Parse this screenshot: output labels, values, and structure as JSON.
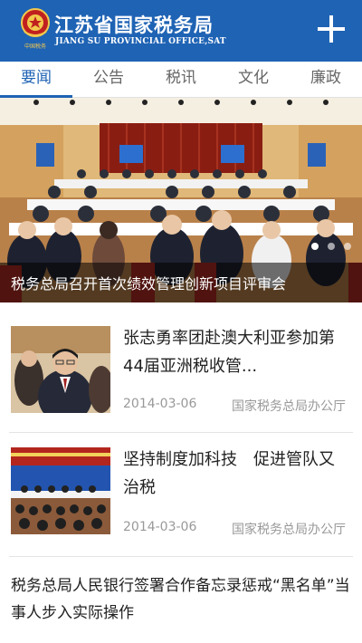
{
  "header": {
    "title": "江苏省国家税务局",
    "subtitle": "JIANG SU PROVINCIAL OFFICE,SAT",
    "logo_text": "中国税务",
    "background": "#1f63b4"
  },
  "tabs": [
    {
      "label": "要闻",
      "active": true
    },
    {
      "label": "公告",
      "active": false
    },
    {
      "label": "税讯",
      "active": false
    },
    {
      "label": "文化",
      "active": false
    },
    {
      "label": "廉政",
      "active": false
    }
  ],
  "banner": {
    "caption": "税务总局召开首次绩效管理创新项目评审会",
    "slide_count": 3,
    "active_slide": 1
  },
  "news": [
    {
      "title": "张志勇率团赴澳大利亚参加第44届亚洲税收管...",
      "date": "2014-03-06",
      "source": "国家税务总局办公厅"
    },
    {
      "title": "坚持制度加科技　促进管队又治税",
      "date": "2014-03-06",
      "source": "国家税务总局办公厅"
    },
    {
      "title": "税务总局人民银行签署合作备忘录惩戒“黑名单”当事人步入实际操作"
    }
  ]
}
